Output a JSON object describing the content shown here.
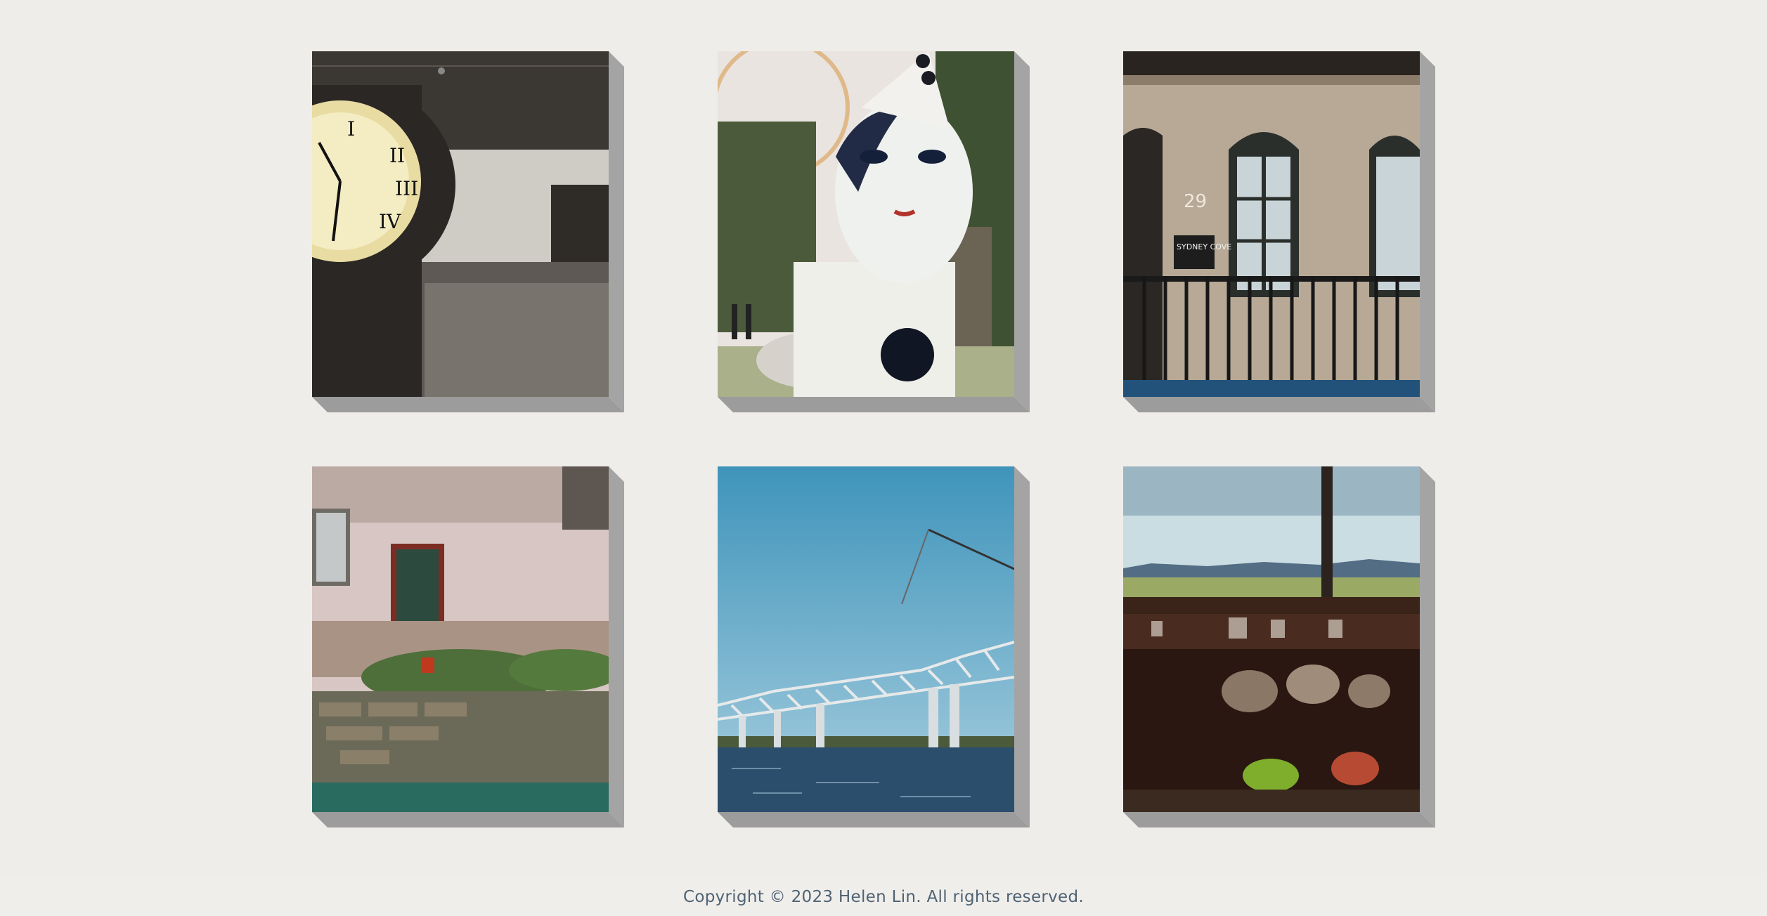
{
  "gallery": {
    "photos": [
      {
        "name": "photo-clock-gallery",
        "icon": "clock-interior-photo",
        "sign_number": "",
        "sign_text": ""
      },
      {
        "name": "photo-pierrot-clown",
        "icon": "clown-statue-photo",
        "sign_number": "",
        "sign_text": ""
      },
      {
        "name": "photo-sydney-cove-building",
        "icon": "sandstone-building-photo",
        "sign_number": "29",
        "sign_text": "SYDNEY COVE"
      },
      {
        "name": "photo-canal-wall",
        "icon": "canal-wall-photo",
        "sign_number": "",
        "sign_text": ""
      },
      {
        "name": "photo-truss-bridge",
        "icon": "bridge-river-photo",
        "sign_number": "",
        "sign_text": ""
      },
      {
        "name": "photo-window-view",
        "icon": "window-landscape-photo",
        "sign_number": "",
        "sign_text": ""
      }
    ]
  },
  "footer": {
    "copyright": "Copyright © 2023 Helen Lin. All rights reserved."
  },
  "colors": {
    "background": "#efede9",
    "tile_shadow": "#a4a4a4",
    "footer_text": "#4f6373"
  }
}
